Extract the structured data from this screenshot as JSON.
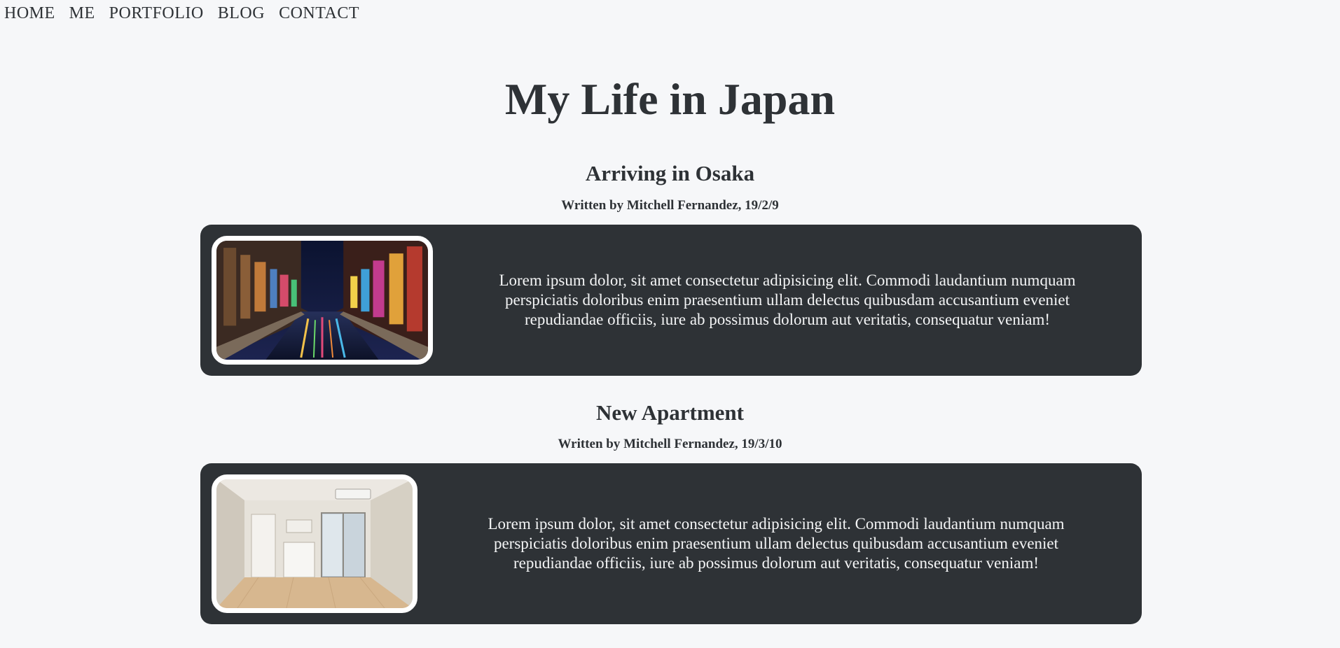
{
  "nav": {
    "items": [
      {
        "label": "HOME"
      },
      {
        "label": "ME"
      },
      {
        "label": "PORTFOLIO"
      },
      {
        "label": "BLOG"
      },
      {
        "label": "CONTACT"
      }
    ]
  },
  "page": {
    "title": "My Life in Japan"
  },
  "posts": [
    {
      "title": "Arriving in Osaka",
      "byline": "Written by Mitchell Fernandez, 19/2/9",
      "body": "Lorem ipsum dolor, sit amet consectetur adipisicing elit. Commodi laudantium numquam perspiciatis doloribus enim praesentium ullam delectus quibusdam accusantium eveniet repudiandae officiis, iure ab possimus dolorum aut veritatis, consequatur veniam!",
      "image": "osaka-night-canal-photo"
    },
    {
      "title": "New Apartment",
      "byline": "Written by Mitchell Fernandez, 19/3/10",
      "body": "Lorem ipsum dolor, sit amet consectetur adipisicing elit. Commodi laudantium numquam perspiciatis doloribus enim praesentium ullam delectus quibusdam accusantium eveniet repudiandae officiis, iure ab possimus dolorum aut veritatis, consequatur veniam!",
      "image": "empty-apartment-photo"
    }
  ],
  "colors": {
    "background": "#f6f7f9",
    "text": "#2e3236",
    "card": "#2e3236",
    "card_text": "#f4f5f6",
    "frame": "#ffffff"
  }
}
